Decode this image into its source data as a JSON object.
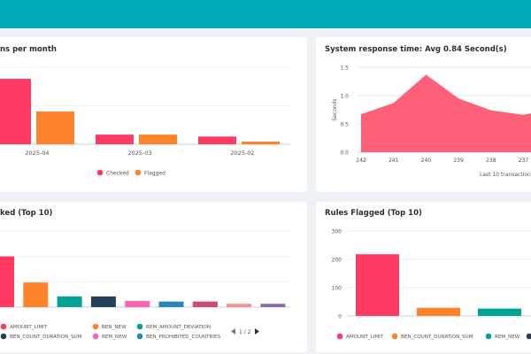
{
  "colors": {
    "header": "#00acb9",
    "background": "#eef2f6",
    "checked": "#ff3b63",
    "flagged": "#ff832b",
    "area": "#ff6079"
  },
  "cards": {
    "per_month_title": "ns per month",
    "response_title": "System response time: Avg 0.84 Second(s)",
    "checked_title": "ked (Top 10)",
    "flagged_title": "Rules Flagged (Top 10)"
  },
  "chart_data": [
    {
      "type": "bar",
      "title": "ns per month",
      "categories": [
        "2025-04",
        "2025-03",
        "2025-02"
      ],
      "series": [
        {
          "name": "Checked",
          "color": "#ff3b63",
          "values": [
            1.7,
            0.25,
            0.2
          ]
        },
        {
          "name": "Flagged",
          "color": "#ff832b",
          "values": [
            0.85,
            0.25,
            0.07
          ]
        }
      ],
      "ylim": [
        0,
        2
      ],
      "grid": true,
      "legend": "bottom"
    },
    {
      "type": "area",
      "title": "System response time: Avg 0.84 Second(s)",
      "xlabel": "Last 10 transaction",
      "ylabel": "Seconds",
      "x": [
        "242",
        "241",
        "240",
        "239",
        "238",
        "237"
      ],
      "values": [
        0.67,
        0.87,
        1.37,
        0.95,
        0.74,
        0.66
      ],
      "yticks": [
        "0.0",
        "0.5",
        "1.0",
        "1.5"
      ],
      "ylim": [
        0,
        1.5
      ],
      "color": "#ff6079",
      "grid": true
    },
    {
      "type": "bar",
      "title": "ked (Top 10)",
      "categories": [
        "AMOUNT_LIMIT",
        "BEN_NEW",
        "REM_AMOUNT_DEVIATION",
        "BEN_COUNT_DURATION_SUM",
        "REM_NEW",
        "BEN_PROHIBITED_COUNTRIES",
        "",
        "",
        ""
      ],
      "values": [
        200,
        97,
        42,
        42,
        24,
        22,
        22,
        13,
        13
      ],
      "colors": [
        "#ff3b63",
        "#ff832b",
        "#00a394",
        "#25405a",
        "#ff63b0",
        "#2a86b8",
        "#cc4a7a",
        "#ff8f8f",
        "#8a6aa8"
      ],
      "ylim": [
        0,
        300
      ],
      "grid": true,
      "legend": "bottom",
      "legend_page": "1 / 2"
    },
    {
      "type": "bar",
      "title": "Rules Flagged (Top 10)",
      "categories": [
        "AMOUNT_LIMIT",
        "BEN_COUNT_DURATION_SUM",
        "REM_NEW",
        ""
      ],
      "values": [
        218,
        29,
        26,
        10
      ],
      "colors": [
        "#ff3b63",
        "#ff832b",
        "#00a394",
        "#25405a"
      ],
      "yticks": [
        "0",
        "100",
        "200",
        "300"
      ],
      "ylim": [
        0,
        300
      ],
      "grid": true,
      "legend": "bottom"
    }
  ]
}
